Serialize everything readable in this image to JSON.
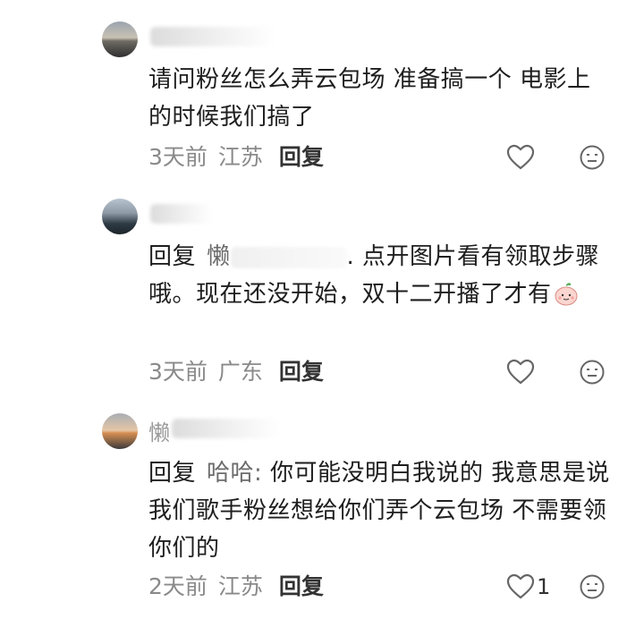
{
  "comments": [
    {
      "text": "请问粉丝怎么弄云包场 准备搞一个 电影上的时候我们搞了",
      "time": "3天前",
      "location": "江苏",
      "reply_label": "回复"
    },
    {
      "reply_prefix": "回复",
      "reply_to": "懒",
      "text_after": ". 点开图片看有领取步骤哦。现在还没开始，双十二开播了才有",
      "time": "3天前",
      "location": "广东",
      "reply_label": "回复"
    },
    {
      "name_initial": "懒",
      "reply_prefix": "回复",
      "reply_to": "哈哈:",
      "text_after": "你可能没明白我说的 我意思是说 我们歌手粉丝想给你们弄个云包场 不需要领你们的",
      "time": "2天前",
      "location": "江苏",
      "reply_label": "回复",
      "likes": "1"
    }
  ],
  "icons": {
    "like": "heart-outline-icon",
    "react": "neutral-face-icon",
    "emoji": "peach-emoji-icon"
  }
}
